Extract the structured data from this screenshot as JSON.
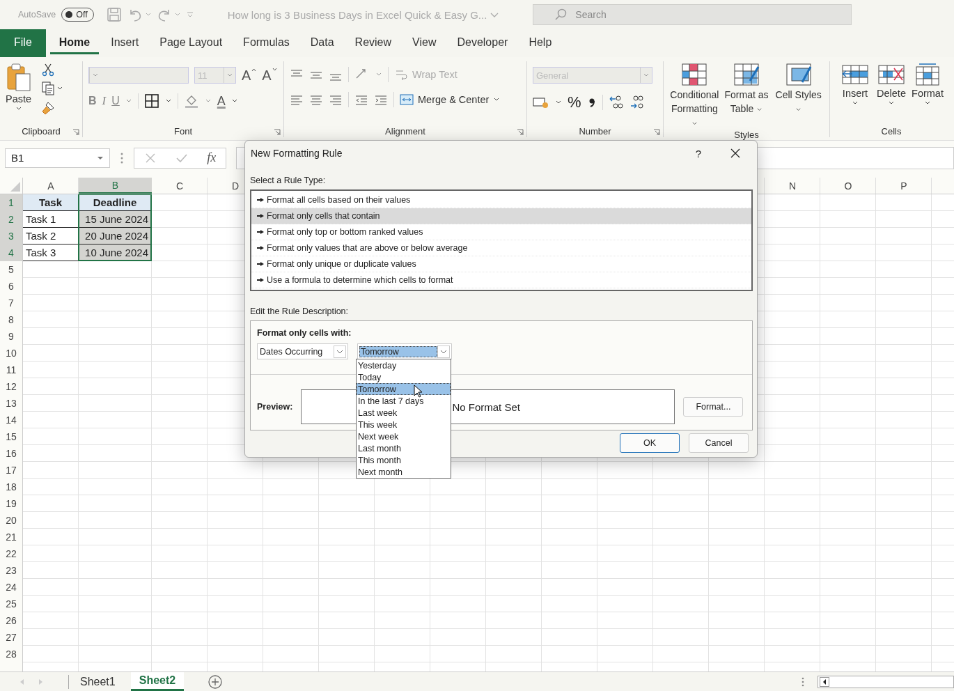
{
  "title_bar": {
    "autosave_label": "AutoSave",
    "autosave": {
      "label": "Off",
      "on": false
    },
    "document_title": "How long is 3 Business Days in Excel Quick & Easy G...",
    "search": {
      "placeholder": "Search"
    }
  },
  "menu_tabs": [
    {
      "label": "File",
      "kind": "file",
      "selected": false
    },
    {
      "label": "Home",
      "kind": "tab",
      "selected": true
    },
    {
      "label": "Insert",
      "kind": "tab",
      "selected": false
    },
    {
      "label": "Page Layout",
      "kind": "tab",
      "selected": false
    },
    {
      "label": "Formulas",
      "kind": "tab",
      "selected": false
    },
    {
      "label": "Data",
      "kind": "tab",
      "selected": false
    },
    {
      "label": "Review",
      "kind": "tab",
      "selected": false
    },
    {
      "label": "View",
      "kind": "tab",
      "selected": false
    },
    {
      "label": "Developer",
      "kind": "tab",
      "selected": false
    },
    {
      "label": "Help",
      "kind": "tab",
      "selected": false
    }
  ],
  "ribbon": {
    "clipboard": {
      "paste": "Paste",
      "label": "Clipboard"
    },
    "font": {
      "label": "Font",
      "font_size": {
        "value": "11",
        "disabled": true
      },
      "grow": "A",
      "shrink": "A",
      "bold": "B",
      "italic": "I",
      "underline": "U",
      "font_color": "A"
    },
    "alignment": {
      "label": "Alignment",
      "wrap_text": {
        "label": "Wrap Text",
        "disabled": true
      },
      "merge": "Merge & Center"
    },
    "number": {
      "label": "Number",
      "format": {
        "value": "General",
        "disabled": true
      },
      "percent": "%"
    },
    "styles": {
      "label": "Styles",
      "buttons": [
        {
          "label": "Conditional Formatting",
          "kind": "conditional"
        },
        {
          "label": "Format as Table",
          "kind": "table"
        },
        {
          "label": "Cell Styles",
          "kind": "styles"
        }
      ]
    },
    "cells": {
      "label": "Cells",
      "buttons": [
        {
          "label": "Insert",
          "kind": "insert"
        },
        {
          "label": "Delete",
          "kind": "delete"
        },
        {
          "label": "Format",
          "kind": "format"
        }
      ]
    }
  },
  "formula_bar": {
    "name_box": "B1",
    "function_glyph": "fx"
  },
  "sheet": {
    "columns": [
      {
        "label": "A",
        "selected": false
      },
      {
        "label": "B",
        "selected": true
      },
      {
        "label": "C",
        "selected": false
      },
      {
        "label": "D",
        "selected": false
      },
      {
        "label": "N",
        "selected": false
      },
      {
        "label": "O",
        "selected": false
      },
      {
        "label": "P",
        "selected": false
      }
    ],
    "rows": [
      {
        "number": "1",
        "selected": true,
        "kind": "header",
        "cells": [
          {
            "text": "Task",
            "selected": false
          },
          {
            "text": "Deadline",
            "selected": false
          }
        ]
      },
      {
        "number": "2",
        "selected": true,
        "kind": "data",
        "cells": [
          {
            "text": "Task 1",
            "selected": false
          },
          {
            "text": "15 June 2024",
            "selected": true
          }
        ]
      },
      {
        "number": "3",
        "selected": true,
        "kind": "data",
        "cells": [
          {
            "text": "Task 2",
            "selected": false
          },
          {
            "text": "20 June 2024",
            "selected": true
          }
        ]
      },
      {
        "number": "4",
        "selected": true,
        "kind": "data",
        "cells": [
          {
            "text": "Task 3",
            "selected": false
          },
          {
            "text": "10 June 2024",
            "selected": true
          }
        ]
      },
      {
        "number": "5",
        "selected": false
      },
      {
        "number": "6",
        "selected": false
      },
      {
        "number": "7",
        "selected": false
      },
      {
        "number": "8",
        "selected": false
      },
      {
        "number": "9",
        "selected": false
      },
      {
        "number": "10",
        "selected": false
      },
      {
        "number": "11",
        "selected": false
      },
      {
        "number": "12",
        "selected": false
      },
      {
        "number": "13",
        "selected": false
      },
      {
        "number": "14",
        "selected": false
      },
      {
        "number": "15",
        "selected": false
      },
      {
        "number": "16",
        "selected": false
      },
      {
        "number": "17",
        "selected": false
      },
      {
        "number": "18",
        "selected": false
      },
      {
        "number": "19",
        "selected": false
      },
      {
        "number": "20",
        "selected": false
      },
      {
        "number": "21",
        "selected": false
      },
      {
        "number": "22",
        "selected": false
      },
      {
        "number": "23",
        "selected": false
      },
      {
        "number": "24",
        "selected": false
      },
      {
        "number": "25",
        "selected": false
      },
      {
        "number": "26",
        "selected": false
      },
      {
        "number": "27",
        "selected": false
      },
      {
        "number": "28",
        "selected": false
      }
    ]
  },
  "sheet_tabs": [
    {
      "label": "Sheet1",
      "selected": false
    },
    {
      "label": "Sheet2",
      "selected": true
    }
  ],
  "dialog": {
    "title": "New Formatting Rule",
    "help": "?",
    "rule_type_label": "Select a Rule Type:",
    "rule_types": [
      {
        "label": "Format all cells based on their values",
        "selected": false
      },
      {
        "label": "Format only cells that contain",
        "selected": true
      },
      {
        "label": "Format only top or bottom ranked values",
        "selected": false
      },
      {
        "label": "Format only values that are above or below average",
        "selected": false
      },
      {
        "label": "Format only unique or duplicate values",
        "selected": false
      },
      {
        "label": "Use a formula to determine which cells to format",
        "selected": false
      }
    ],
    "description_label": "Edit the Rule Description:",
    "condition_label": "Format only cells with:",
    "condition": "Dates Occurring",
    "period": "Tomorrow",
    "period_options": [
      {
        "label": "Yesterday",
        "selected": false
      },
      {
        "label": "Today",
        "selected": false
      },
      {
        "label": "Tomorrow",
        "selected": true
      },
      {
        "label": "In the last 7 days",
        "selected": false
      },
      {
        "label": "Last week",
        "selected": false
      },
      {
        "label": "This week",
        "selected": false
      },
      {
        "label": "Next week",
        "selected": false
      },
      {
        "label": "Last month",
        "selected": false
      },
      {
        "label": "This month",
        "selected": false
      },
      {
        "label": "Next month",
        "selected": false
      }
    ],
    "preview_label": "Preview:",
    "preview_text": "No Format Set",
    "format_button": "Format...",
    "ok": "OK",
    "cancel": "Cancel"
  }
}
